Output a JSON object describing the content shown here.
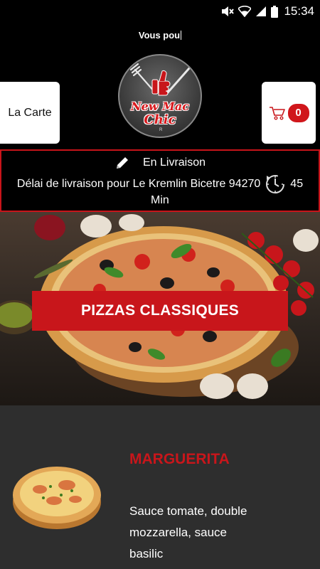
{
  "status_bar": {
    "time": "15:34",
    "icons": [
      "mute-icon",
      "wifi-icon",
      "signal-icon",
      "battery-icon"
    ]
  },
  "header": {
    "typing_text": "Vous pou",
    "logo": {
      "line1": "New Mac",
      "line2": "Chic",
      "mark": "R"
    },
    "menu_button_label": "La Carte",
    "cart": {
      "icon": "cart-icon",
      "count": "0"
    }
  },
  "delivery": {
    "edit_icon": "pencil-icon",
    "mode": "En Livraison",
    "info_prefix": "Délai de livraison pour Le Kremlin Bicetre 94270",
    "clock_icon": "clock-icon",
    "duration": "45",
    "unit": "Min"
  },
  "category": {
    "title": "PIZZAS CLASSIQUES"
  },
  "products": [
    {
      "name": "MARGUERITA",
      "description": "Sauce tomate, double mozzarella, sauce basilic"
    }
  ],
  "colors": {
    "accent": "#c8161b",
    "background": "#000000",
    "panel": "#2e2e2e"
  }
}
